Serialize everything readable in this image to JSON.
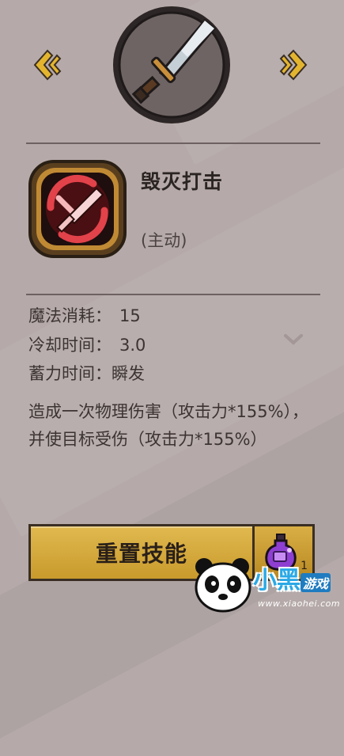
{
  "colors": {
    "background": "#b5aaa9",
    "accent_gold": "#e0b94f",
    "skill_red": "#c9282d",
    "watermark_blue": "#2aa9e6"
  },
  "header": {
    "prev_icon": "double-chevron-left-icon",
    "next_icon": "double-chevron-right-icon",
    "weapon_icon": "sword-icon"
  },
  "skill": {
    "icon": "destroy-strike-icon",
    "name": "毁灭打击",
    "type": "(主动)"
  },
  "stats": [
    {
      "label": "魔法消耗：",
      "value": "15"
    },
    {
      "label": "冷却时间：",
      "value": "3.0"
    },
    {
      "label": "蓄力时间：",
      "value": "瞬发"
    }
  ],
  "description": "造成一次物理伤害（攻击力*155%），并使目标受伤（攻击力*155%）",
  "reset": {
    "label": "重置技能",
    "cost_icon": "purple-potion-icon",
    "cost_count": "1"
  },
  "watermark": {
    "title": "小黑",
    "subtitle": "游戏",
    "url": "www.xiaohei.com"
  }
}
